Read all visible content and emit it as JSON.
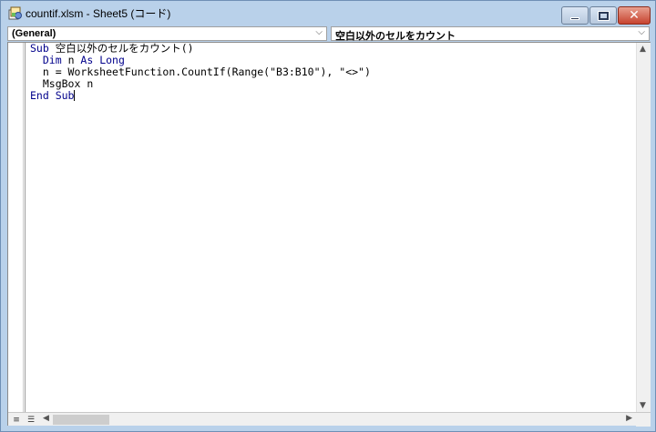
{
  "window": {
    "title": "countif.xlsm - Sheet5 (コード)"
  },
  "combos": {
    "object": "(General)",
    "procedure": "空白以外のセルをカウント"
  },
  "code": {
    "line1_kw": "Sub",
    "line1_rest": " 空白以外のセルをカウント()",
    "line2_kw1": "Dim",
    "line2_mid": " n ",
    "line2_kw2": "As Long",
    "line3": "n = WorksheetFunction.CountIf(Range(\"B3:B10\"), \"<>\")",
    "line4": "MsgBox n",
    "line5_kw": "End Sub"
  },
  "colors": {
    "keyword": "#00008b",
    "titlebar": "#b9d1ea"
  }
}
